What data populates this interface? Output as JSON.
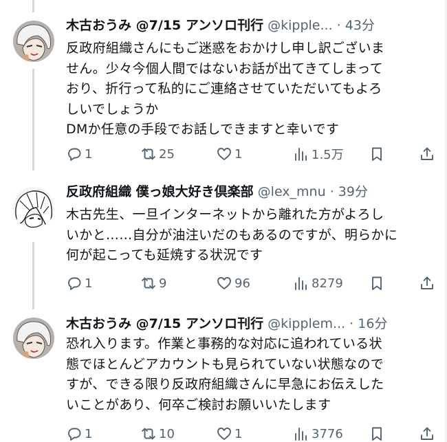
{
  "tweets": [
    {
      "display_name": "木古おうみ @7/15 アンソロ刊行",
      "handle": "@kipple...",
      "separator": "·",
      "time": "43分",
      "lines": [
        "反政府組織さんにもご迷惑をおかけし申し訳ございま",
        "せん。少々今個人間ではないお話が出てきてしまって",
        "おり、折行って私的にご連絡させていただいてもよろ",
        "しいでしょうか",
        "DMか任意の手段でお話しできますと幸いです"
      ],
      "replies": "1",
      "retweets": "25",
      "likes": "1",
      "views": "1.5万"
    },
    {
      "display_name": "反政府組織 僕っ娘大好き倶楽部",
      "handle": "@lex_mnu",
      "separator": "·",
      "time": "39分",
      "lines": [
        "木古先生、一旦インターネットから離れた方がよろし",
        "いかと……自分が油注いだのもあるのですが、明らかに",
        "何が起こっても延焼する状況です"
      ],
      "replies": "1",
      "retweets": "9",
      "likes": "96",
      "views": "8279"
    },
    {
      "display_name": "木古おうみ @7/15 アンソロ刊行",
      "handle": "@kipplem...",
      "separator": "·",
      "time": "16分",
      "lines": [
        "恐れ入ります。作業と事務的な対応に追われている状",
        "態でほとんどアカウントも見られていない状態なので",
        "すが、できる限り反政府組織さんに早急にお伝えした",
        "いことがあり、何卒ご検討お願いいたします"
      ],
      "replies": "1",
      "retweets": "10",
      "likes": "1",
      "views": "3776"
    }
  ]
}
